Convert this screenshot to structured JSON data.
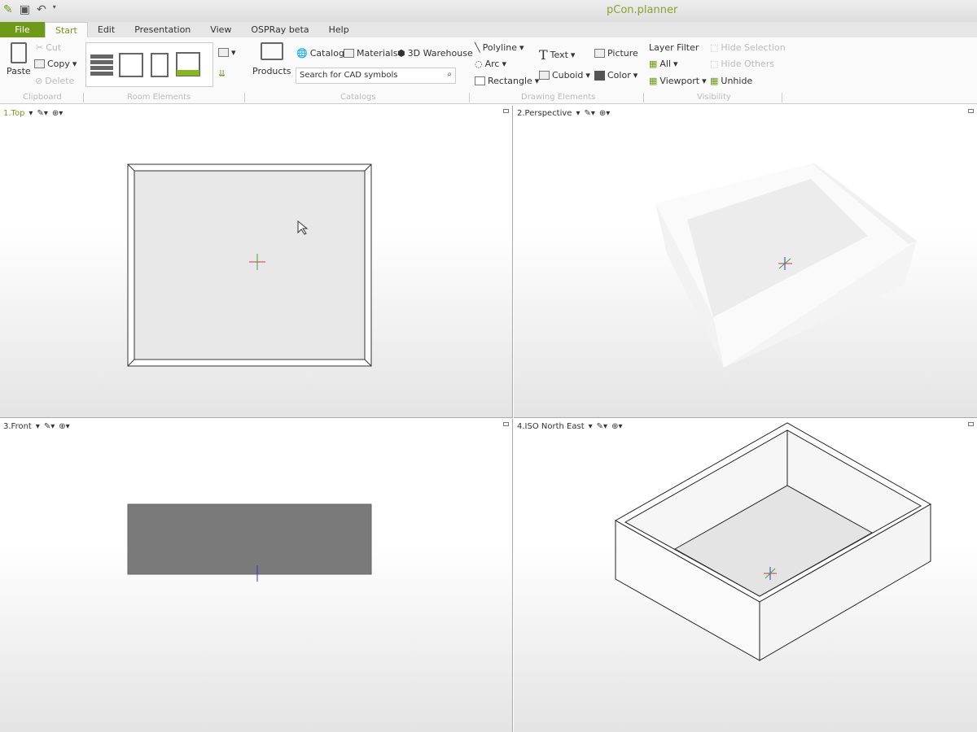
{
  "app_title": "pCon.planner",
  "tabs": [
    "File",
    "Start",
    "Edit",
    "Presentation",
    "View",
    "OSPRay beta",
    "Help"
  ],
  "clipboard": {
    "paste": "Paste",
    "cut": "Cut",
    "copy": "Copy",
    "delete": "Delete",
    "group": "Clipboard"
  },
  "room_elements": {
    "group": "Room Elements"
  },
  "catalogs": {
    "products": "Products",
    "catalog": "Catalog",
    "materials": "Materials",
    "warehouse": "3D Warehouse",
    "search_placeholder": "Search for CAD symbols",
    "group": "Catalogs"
  },
  "drawing": {
    "polyline": "Polyline",
    "arc": "Arc",
    "rectangle": "Rectangle",
    "text": "Text",
    "cuboid": "Cuboid",
    "picture": "Picture",
    "color": "Color",
    "group": "Drawing Elements"
  },
  "visibility": {
    "layer_filter": "Layer Filter",
    "all": "All",
    "viewport": "Viewport",
    "hide_selection": "Hide Selection",
    "hide_others": "Hide Others",
    "unhide": "Unhide",
    "group": "Visibility"
  },
  "viewports": [
    "1.Top",
    "2.Perspective",
    "3.Front",
    "4.ISO North East"
  ],
  "accent": "#6f9a17"
}
